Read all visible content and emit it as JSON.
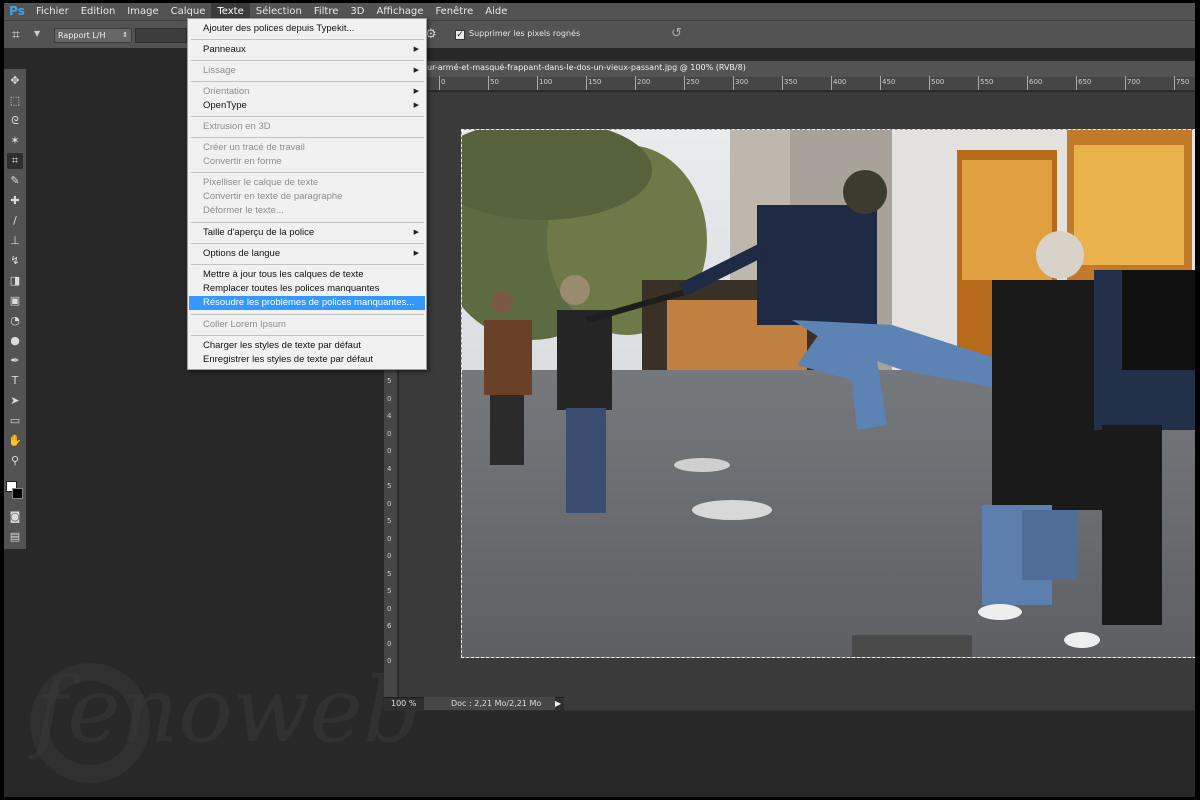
{
  "app": {
    "logo": "Ps"
  },
  "menubar": {
    "items": [
      "Fichier",
      "Edition",
      "Image",
      "Calque",
      "Texte",
      "Sélection",
      "Filtre",
      "3D",
      "Affichage",
      "Fenêtre",
      "Aide"
    ],
    "active": "Texte"
  },
  "options": {
    "ratio_value": "Rapport L/H",
    "delete_pixels_label": "Supprimer les pixels rognés",
    "delete_pixels_checked": true
  },
  "document": {
    "title": "ur-armé-et-masqué-frappant-dans-le-dos-un-vieux-passant.jpg @ 100% (RVB/8)",
    "zoom": "100 %",
    "doc_size": "Doc : 2,21 Mo/2,21 Mo",
    "ruler_top": [
      "-50",
      "0",
      "50",
      "100",
      "150",
      "200",
      "250",
      "300",
      "350",
      "400",
      "450",
      "500",
      "550",
      "600",
      "650",
      "700",
      "750"
    ],
    "ruler_left": [
      "0",
      "5",
      "0",
      "1",
      "5",
      "0",
      "2",
      "0",
      "0",
      "2",
      "5",
      "0",
      "3",
      "0",
      "0",
      "3",
      "5",
      "0",
      "4",
      "0",
      "0",
      "4",
      "5",
      "0",
      "5",
      "0",
      "0",
      "5",
      "5",
      "0",
      "6",
      "0",
      "0"
    ]
  },
  "dropdown": {
    "items": [
      {
        "label": "Ajouter des polices depuis Typekit...",
        "disabled": false
      },
      {
        "label": "Panneaux",
        "disabled": false,
        "submenu": true
      },
      {
        "label": "Lissage",
        "disabled": true,
        "submenu": true
      },
      {
        "label": "Orientation",
        "disabled": true,
        "submenu": true
      },
      {
        "label": "OpenType",
        "disabled": false,
        "submenu": true
      },
      {
        "label": "Extrusion en 3D",
        "disabled": true
      },
      {
        "label": "Créer un tracé de travail",
        "disabled": true
      },
      {
        "label": "Convertir en forme",
        "disabled": true
      },
      {
        "label": "Pixelliser le calque de texte",
        "disabled": true
      },
      {
        "label": "Convertir en texte de paragraphe",
        "disabled": true
      },
      {
        "label": "Déformer le texte...",
        "disabled": true
      },
      {
        "label": "Taille d'aperçu de la police",
        "disabled": false,
        "submenu": true
      },
      {
        "label": "Options de langue",
        "disabled": false,
        "submenu": true
      },
      {
        "label": "Mettre à jour tous les calques de texte",
        "disabled": false
      },
      {
        "label": "Remplacer toutes les polices manquantes",
        "disabled": false
      },
      {
        "label": "Résoudre les problèmes de polices manquantes...",
        "disabled": false,
        "highlighted": true
      },
      {
        "label": "Coller Lorem Ipsum",
        "disabled": true
      },
      {
        "label": "Charger les styles de texte par défaut",
        "disabled": false
      },
      {
        "label": "Enregistrer les styles de texte par défaut",
        "disabled": false
      }
    ]
  },
  "watermark": {
    "text": "fenoweb"
  }
}
